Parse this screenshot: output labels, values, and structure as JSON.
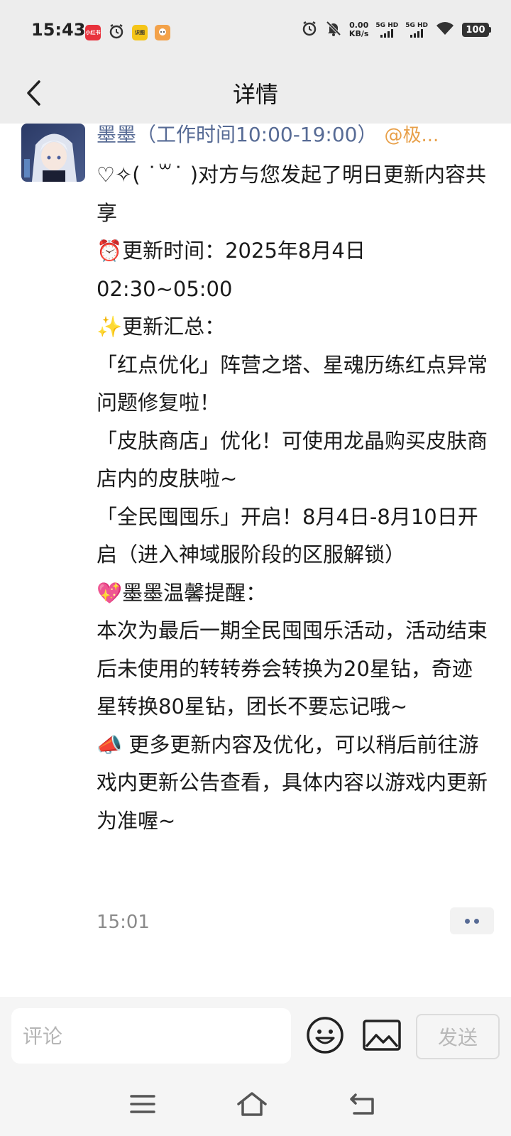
{
  "status_bar": {
    "time": "15:43",
    "app_badges": [
      "小红书",
      "alarm-icon",
      "识图",
      "avatar-app"
    ],
    "net_speed_value": "0.00",
    "net_speed_unit": "KB/s",
    "signal_1_label": "5G HD",
    "signal_2_label": "5G HD",
    "battery": "100"
  },
  "nav": {
    "title": "详情",
    "back_icon": "chevron-left-icon"
  },
  "post": {
    "author_name": "墨墨（工作时间10:00-19:00）",
    "author_mention": "@极...",
    "lines": [
      "♡✧( ˙꒳˙ )对方与您发起了明日更新内容共享",
      "⏰更新时间：2025年8月4日02:30~05:00",
      "✨更新汇总：",
      "「红点优化」阵营之塔、星魂历练红点异常问题修复啦！",
      "「皮肤商店」优化！可使用龙晶购买皮肤商店内的皮肤啦~",
      "「全民囤囤乐」开启！8月4日-8月10日开启（进入神域服阶段的区服解锁）",
      "💖墨墨温馨提醒：",
      "本次为最后一期全民囤囤乐活动，活动结束后未使用的转转券会转换为20星钻，奇迹星转换80星钻，团长不要忘记哦~",
      "📣 更多更新内容及优化，可以稍后前往游戏内更新公告查看，具体内容以游戏内更新为准喔~"
    ],
    "timestamp": "15:01"
  },
  "comment_bar": {
    "placeholder": "评论",
    "send_label": "发送"
  },
  "colors": {
    "author_name": "#576b95",
    "mention": "#e8a04a",
    "bar_bg": "#ededed"
  }
}
